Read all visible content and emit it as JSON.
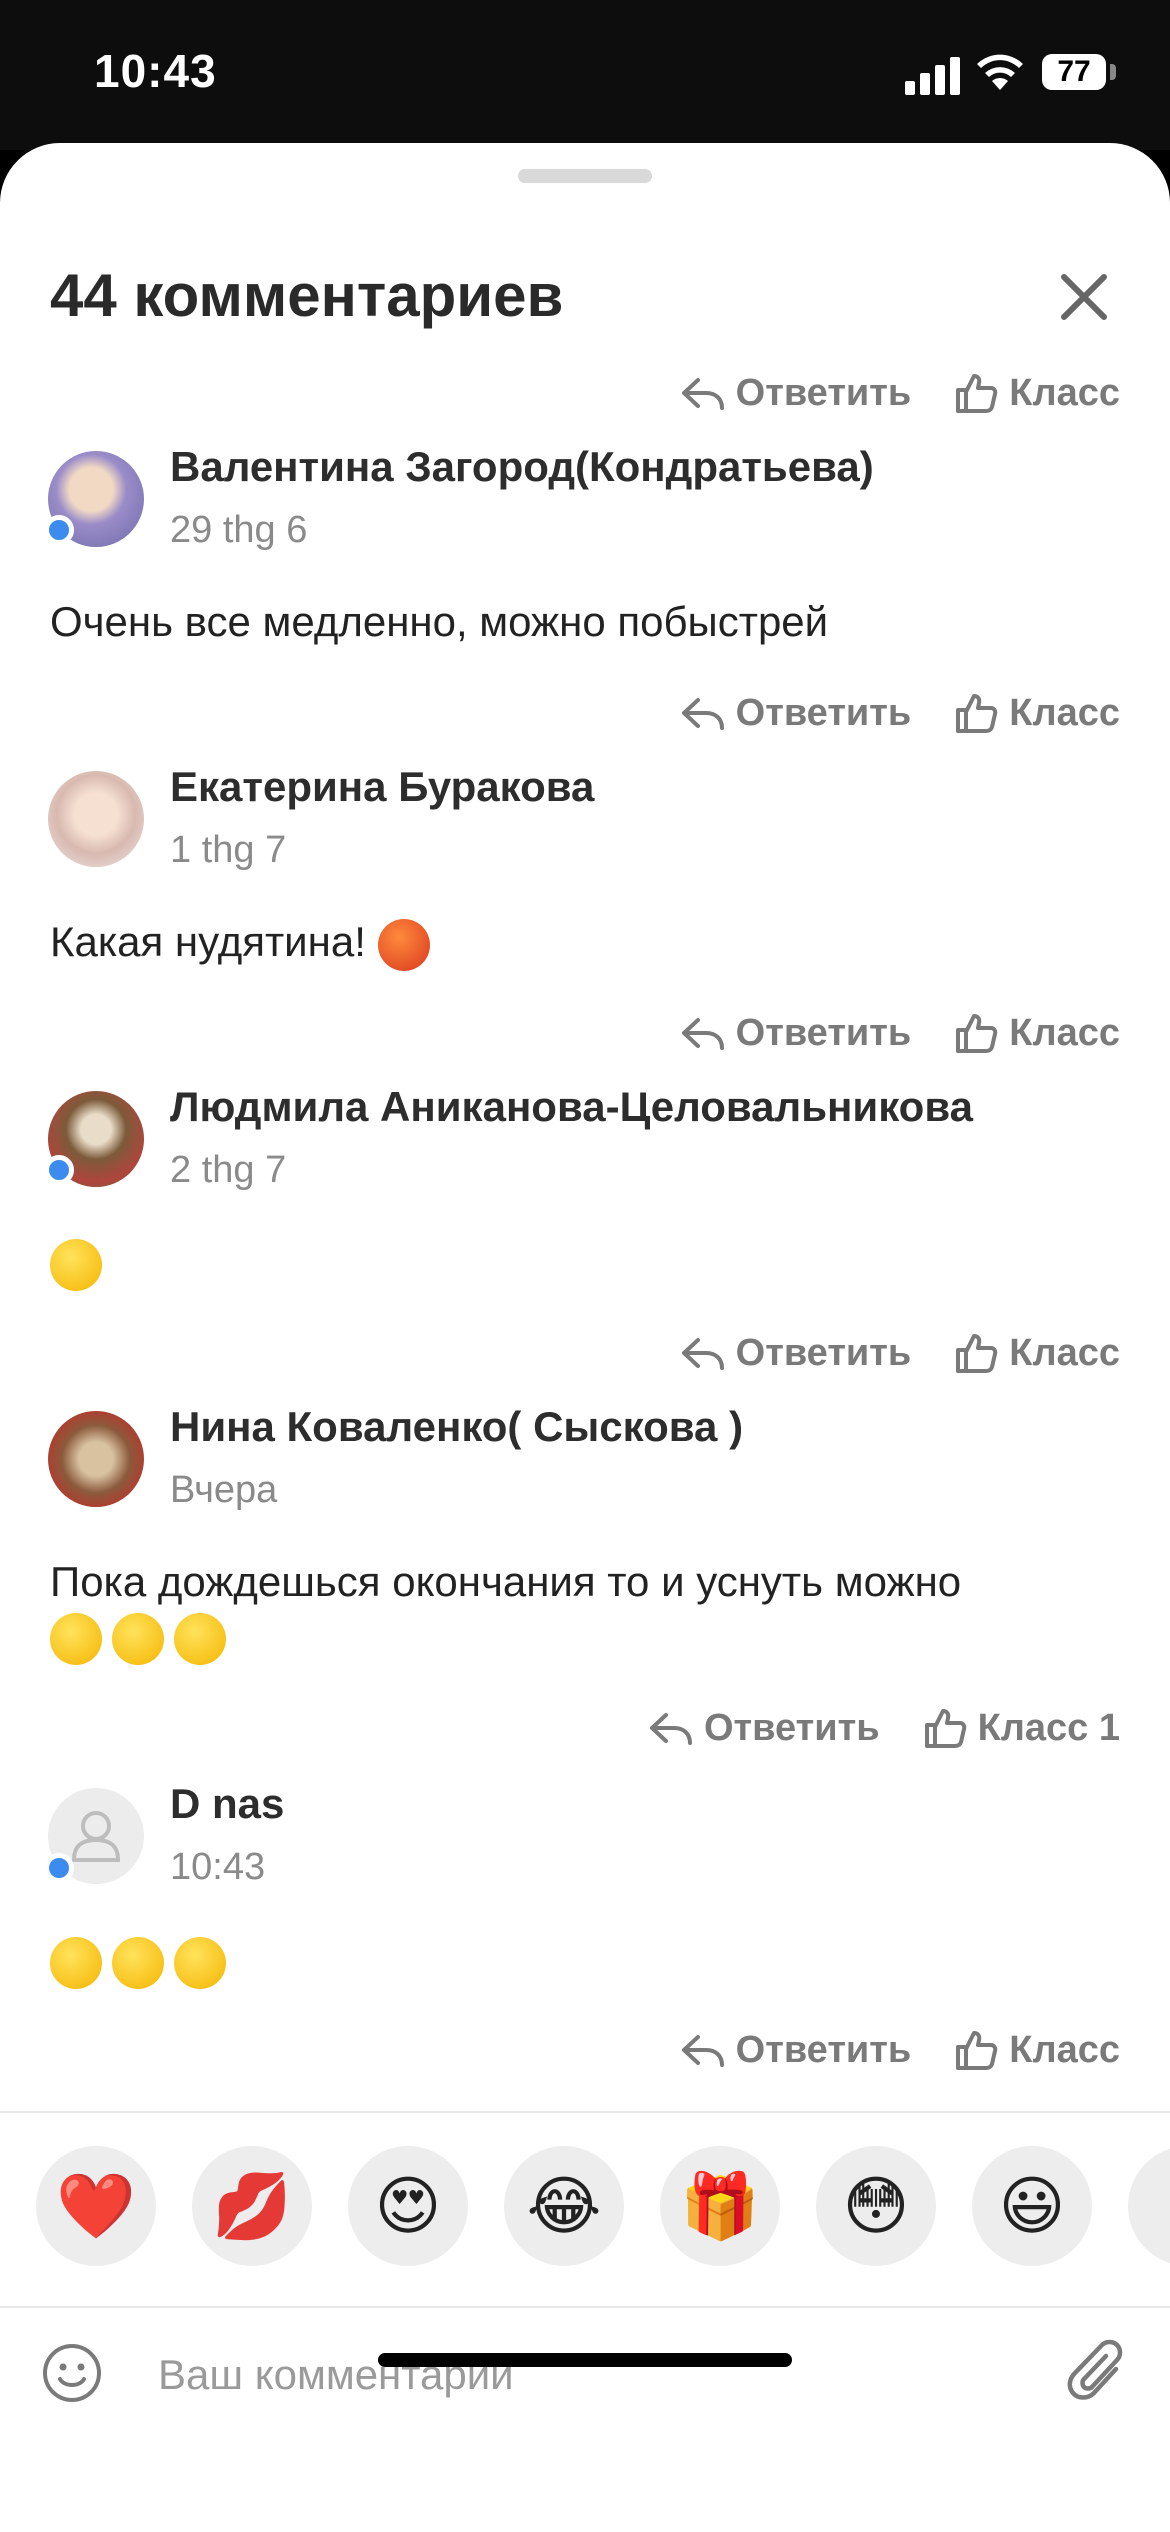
{
  "status_bar": {
    "time": "10:43",
    "battery": "77"
  },
  "sheet": {
    "title": "44 комментариев"
  },
  "labels": {
    "reply": "Ответить",
    "like": "Класс",
    "like_count_label": "Класс 1"
  },
  "comments": [
    {
      "author": "Валентина Загород(Кондратьева)",
      "date": "29 thg 6",
      "text": "Очень все медленно, можно побыстрей",
      "online": true
    },
    {
      "author": "Екатерина Буракова",
      "date": "1 thg 7",
      "text": "Какая нудятина!",
      "emoji": [
        "cursing-face"
      ],
      "online": false
    },
    {
      "author": "Людмила Аниканова-Целовальникова",
      "date": "2 thg 7",
      "text": "",
      "emoji": [
        "flushed-face"
      ],
      "online": true
    },
    {
      "author": "Нина Коваленко( Сыскова )",
      "date": "Вчера",
      "text": "Пока дождешься окончания то и уснуть можно",
      "emoji": [
        "steam-face",
        "steam-face",
        "steam-face"
      ],
      "online": false
    },
    {
      "author": "D nas",
      "date": "10:43",
      "text": "",
      "emoji": [
        "heart-eyes-face",
        "heart-eyes-face",
        "heart-eyes-face"
      ],
      "online": true
    }
  ],
  "reactions": [
    "❤️",
    "💋",
    "😍",
    "😂",
    "🎁",
    "😳",
    "😃"
  ],
  "composer": {
    "placeholder": "Ваш комментарий"
  },
  "colors": {
    "accent": "#3c8cf0",
    "muted": "#7a7a7a"
  }
}
